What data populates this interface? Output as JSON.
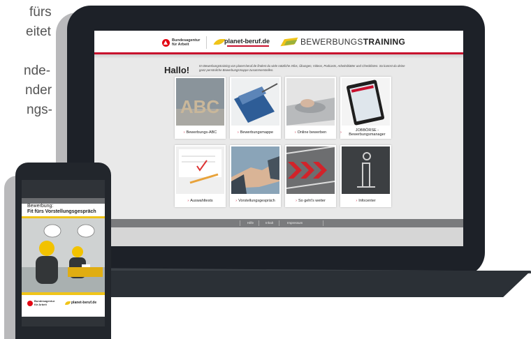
{
  "background_copy": {
    "line1": "fürs",
    "line2": "eitet",
    "line3": "nde-",
    "line4": "nder",
    "line5": "ngs-"
  },
  "website": {
    "header": {
      "agency_logo_text": "Bundesagentur für Arbeit",
      "partner_logo_text": "planet-beruf.de",
      "brand_light": "BEWERBUNGS",
      "brand_bold": "TRAINING"
    },
    "greeting": "Hallo!",
    "intro": "Im Bewerbungstraining von planet-beruf.de findest du viele nützliche Infos, Übungen, Videos, Podcasts, Arbeitsblätter und Checklisten. So kannst du deine ganz persönliche Bewerbungsmappe zusammenstellen.",
    "arrow": "›",
    "tiles": [
      {
        "label": "Bewerbungs-ABC"
      },
      {
        "label": "Bewerbungsmappe"
      },
      {
        "label": "Online bewerben"
      },
      {
        "label": "JOBBÖRSE - Bewerbungsmanager"
      },
      {
        "label": "Auswahltests"
      },
      {
        "label": "Vorstellungsgespräch"
      },
      {
        "label": "So geht's weiter"
      },
      {
        "label": "Infocenter"
      }
    ],
    "footer": {
      "links": [
        "Hilfe",
        "Inhalt",
        "Impressum"
      ]
    }
  },
  "phone": {
    "title_line1": "Bewerbung:",
    "title_line2": "Fit fürs Vorstellungsgespräch",
    "agency_logo_text": "Bundesagentur für Arbeit",
    "partner_logo_text": "planet-beruf.de"
  },
  "colors": {
    "brand_red": "#c8102e",
    "brand_yellow": "#f0c419",
    "device_dark": "#1d2128"
  }
}
